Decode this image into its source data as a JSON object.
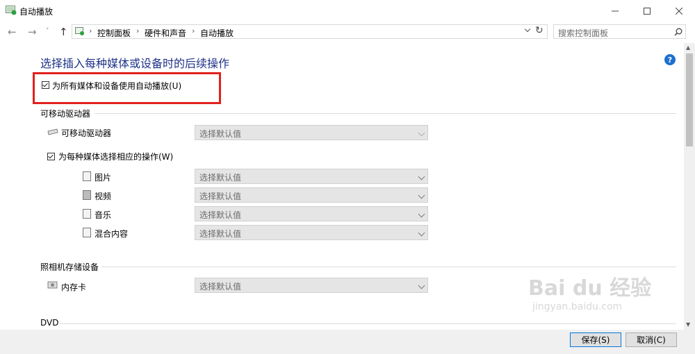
{
  "window": {
    "title": "自动播放"
  },
  "address": {
    "crumbs": [
      "控制面板",
      "硬件和声音",
      "自动播放"
    ]
  },
  "search": {
    "placeholder": "搜索控制面板"
  },
  "page": {
    "title": "选择插入每种媒体或设备时的后续操作",
    "use_autoplay_label": "为所有媒体和设备使用自动播放(U)"
  },
  "removable": {
    "section": "可移动驱动器",
    "drive_label": "可移动驱动器",
    "drive_value": "选择默认值",
    "per_media_label": "为每种媒体选择相应的操作(W)",
    "items": [
      {
        "label": "图片",
        "value": "选择默认值",
        "icon": "picture-file-icon"
      },
      {
        "label": "视频",
        "value": "选择默认值",
        "icon": "video-file-icon"
      },
      {
        "label": "音乐",
        "value": "选择默认值",
        "icon": "music-file-icon"
      },
      {
        "label": "混合内容",
        "value": "选择默认值",
        "icon": "mixed-content-icon"
      }
    ]
  },
  "camera": {
    "section": "照相机存储设备",
    "card_label": "内存卡",
    "card_value": "选择默认值"
  },
  "dvd": {
    "section": "DVD"
  },
  "footer": {
    "save": "保存(S)",
    "cancel": "取消(C)"
  },
  "watermark": {
    "brand": "Bai du 经验",
    "url": "jingyan.baidu.com"
  },
  "colors": {
    "title": "#1e3287",
    "highlight": "#e0211c",
    "help": "#1e6fd0"
  }
}
